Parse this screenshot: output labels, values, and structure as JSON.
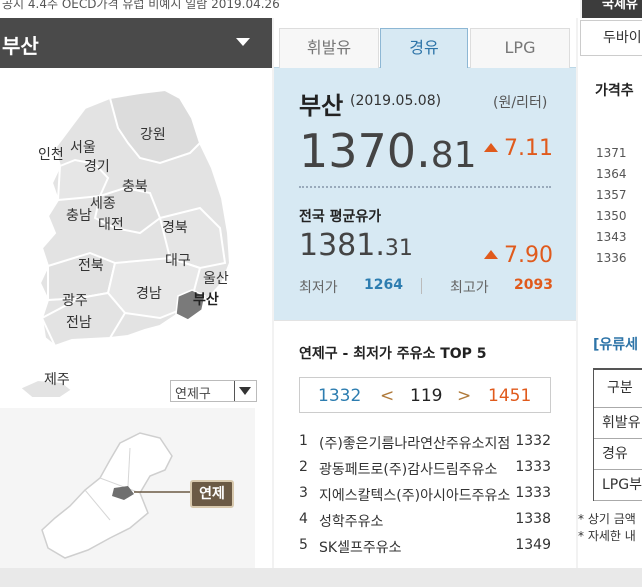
{
  "top_bar": {
    "text": "공지 4.4주 OECD가격 유럽 비예시 일람 2019.04.26",
    "right_button": "국제유"
  },
  "region_selector": {
    "selected": "부산"
  },
  "map": {
    "labels": {
      "seoul": "서울",
      "incheon": "인천",
      "gyeonggi": "경기",
      "gangwon": "강원",
      "chungbuk": "충북",
      "sejong": "세종",
      "chungnam": "충남",
      "daejeon": "대전",
      "gyeongbuk": "경북",
      "jeonbuk": "전북",
      "daegu": "대구",
      "ulsan": "울산",
      "gwangju": "광주",
      "gyeongnam": "경남",
      "busan": "부산",
      "jeonnam": "전남",
      "jeju": "제주"
    },
    "district_select": "연제구",
    "district_tag": "연제"
  },
  "fuel_tabs": [
    {
      "label": "휘발유",
      "active": false
    },
    {
      "label": "경유",
      "active": true
    },
    {
      "label": "LPG",
      "active": false
    }
  ],
  "price_panel": {
    "region": "부산",
    "date": "(2019.05.08)",
    "unit": "(원/리터)",
    "price_int": "1370.",
    "price_dec": "81",
    "change": "7.11",
    "national_title": "전국 평균유가",
    "national_int": "1381.",
    "national_dec": "31",
    "national_change": "7.90",
    "min_label": "최저가",
    "min_value": "1264",
    "max_label": "최고가",
    "max_value": "2093"
  },
  "top5": {
    "title": "연제구 - 최저가 주유소 TOP 5",
    "pager": {
      "low": "1332",
      "prev": "<",
      "current": "119",
      "next": ">",
      "high": "1451"
    },
    "rows": [
      {
        "rank": "1",
        "name": "(주)좋은기름나라연산주유소지점",
        "price": "1332"
      },
      {
        "rank": "2",
        "name": "광동페트로(주)감사드림주유소",
        "price": "1333"
      },
      {
        "rank": "3",
        "name": "지에스칼텍스(주)아시아드주유소",
        "price": "1333"
      },
      {
        "rank": "4",
        "name": "성학주유소",
        "price": "1338"
      },
      {
        "rank": "5",
        "name": "SK셀프주유소",
        "price": "1349"
      }
    ]
  },
  "right_panel": {
    "dubai_tab": "두바이",
    "trend_title": "가격추",
    "trend_ticks": [
      "1371",
      "1364",
      "1357",
      "1350",
      "1343",
      "1336"
    ],
    "fuel_title": "[유류세",
    "fuel_table": [
      "구분",
      "휘발유",
      "경유",
      "LPG부"
    ],
    "notes": [
      "* 상기 금액",
      "* 자세한 내"
    ]
  }
}
